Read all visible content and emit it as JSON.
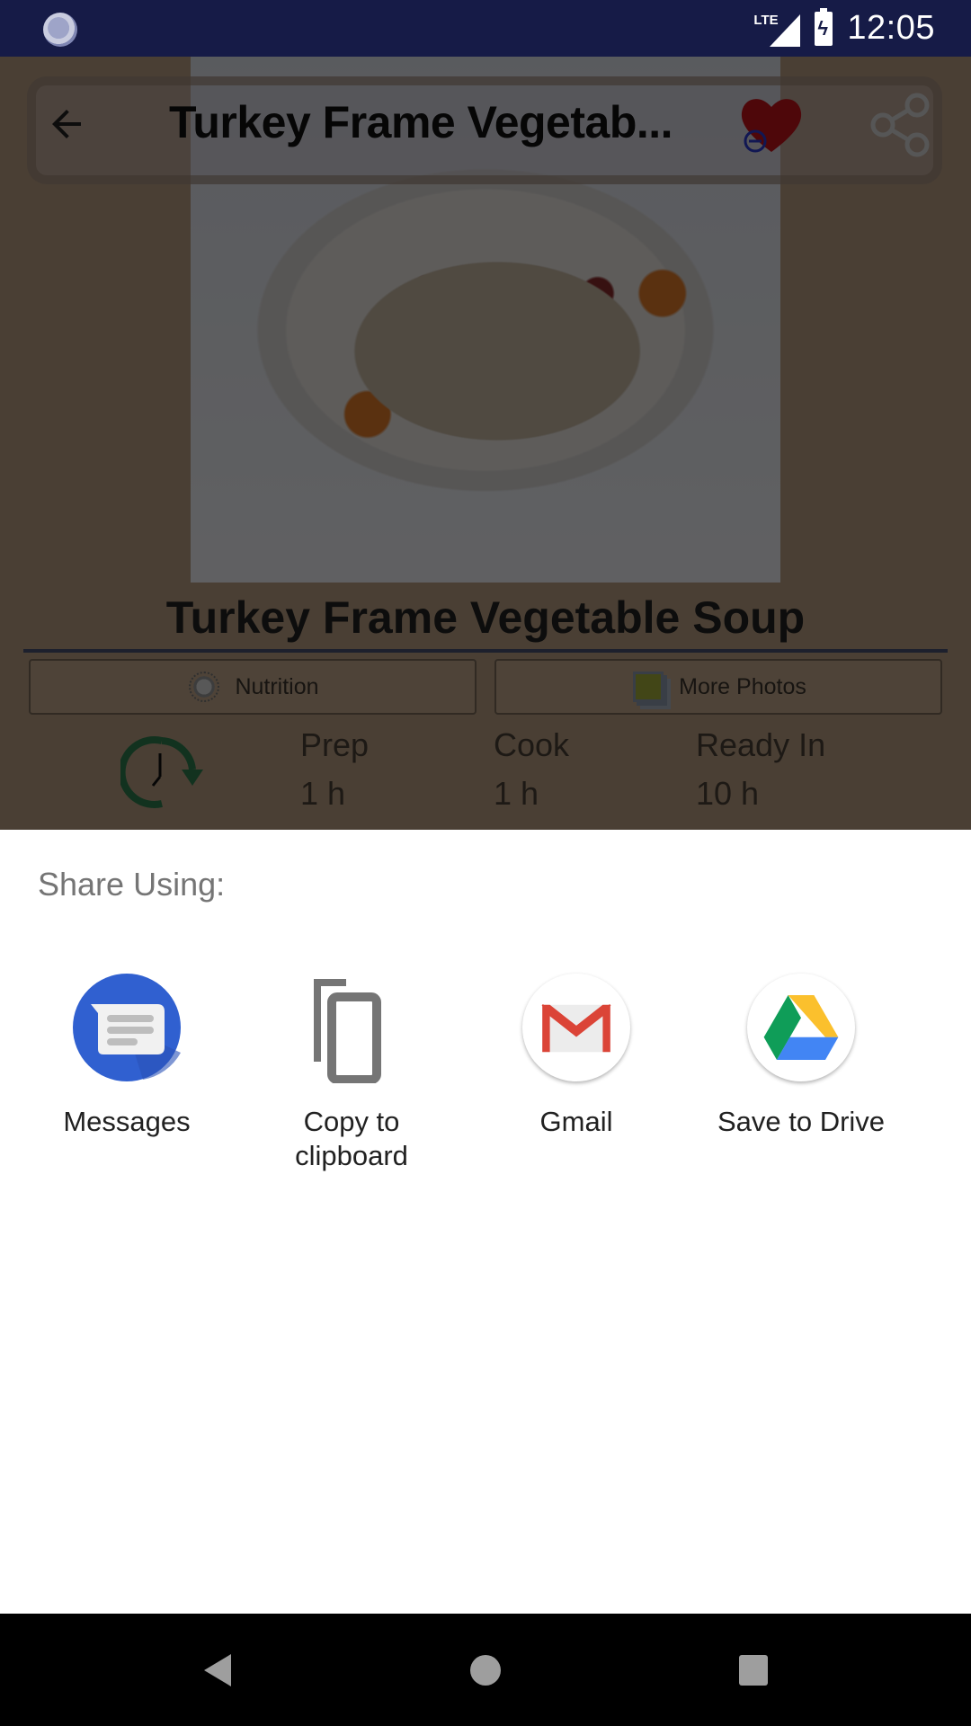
{
  "status_bar": {
    "time": "12:05",
    "network_label": "LTE",
    "icons": [
      "sync-icon",
      "lte-signal-icon",
      "battery-charging-icon"
    ]
  },
  "app": {
    "toolbar_title": "Turkey Frame Vegetab...",
    "recipe_title": "Turkey Frame Vegetable Soup",
    "buttons": [
      {
        "label": "Nutrition",
        "icon": "nutrition-icon"
      },
      {
        "label": "More Photos",
        "icon": "photos-icon"
      }
    ],
    "times": [
      {
        "label": "Prep",
        "value": "1 h"
      },
      {
        "label": "Cook",
        "value": "1 h"
      },
      {
        "label": "Ready In",
        "value": "10 h"
      }
    ],
    "colors": {
      "background": "#b99e82",
      "status_bar": "#161b47",
      "favorite_heart": "#c2121b",
      "clock_icon": "#2e7d4f"
    }
  },
  "share_sheet": {
    "title": "Share Using:",
    "targets": [
      {
        "label": "Messages",
        "icon": "messages-icon"
      },
      {
        "label": "Copy to clipboard",
        "icon": "copy-icon"
      },
      {
        "label": "Gmail",
        "icon": "gmail-icon"
      },
      {
        "label": "Save to Drive",
        "icon": "drive-icon"
      }
    ]
  },
  "nav_bar": {
    "buttons": [
      "back",
      "home",
      "recents"
    ]
  }
}
